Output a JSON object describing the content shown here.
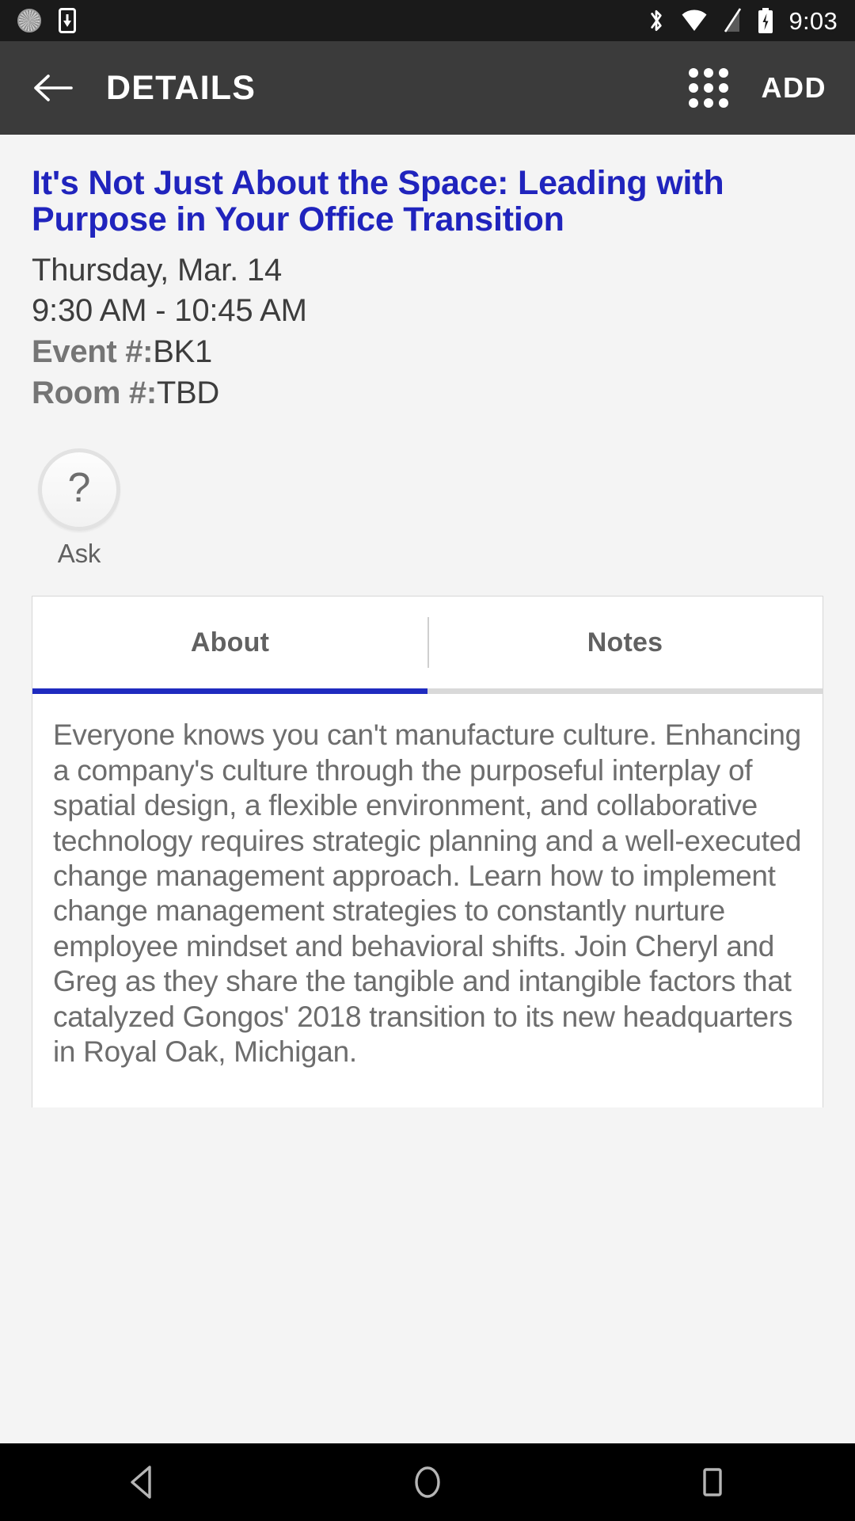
{
  "status_bar": {
    "time": "9:03",
    "left_icons": [
      {
        "name": "sync-icon"
      },
      {
        "name": "download-to-device-icon"
      }
    ],
    "right_icons": [
      {
        "name": "bluetooth-icon"
      },
      {
        "name": "wifi-icon"
      },
      {
        "name": "signal-off-icon"
      },
      {
        "name": "battery-charging-icon"
      }
    ]
  },
  "app_bar": {
    "back_label": "back-arrow",
    "title": "DETAILS",
    "grid_label": "apps-grid",
    "add_label": "ADD"
  },
  "event": {
    "title": "It's Not Just About the Space: Leading with Purpose in Your Office Transition",
    "date": "Thursday, Mar. 14",
    "time": "9:30 AM - 10:45 AM",
    "event_number_label": "Event #:",
    "event_number_value": "BK1",
    "room_number_label": "Room #:",
    "room_number_value": "TBD"
  },
  "ask": {
    "glyph": "?",
    "label": "Ask"
  },
  "tabs": [
    {
      "label": "About",
      "active": true
    },
    {
      "label": "Notes",
      "active": false
    }
  ],
  "about": {
    "text": "Everyone knows you can't manufacture culture. Enhancing a company's culture through the purposeful interplay of spatial design, a flexible environment, and collaborative technology requires strategic planning and a well-executed change management approach. Learn how to implement change management strategies to constantly nurture employee mindset and behavioral shifts. Join Cheryl and Greg as they share the tangible and intangible factors that catalyzed Gongos' 2018 transition to its new headquarters in Royal Oak, Michigan."
  },
  "nav_bar": {
    "back": "nav-back-icon",
    "home": "nav-home-icon",
    "recents": "nav-recents-icon"
  },
  "colors": {
    "title_blue": "#2024bd",
    "tab_indicator": "#1f2bbf",
    "app_bar": "#3b3b3b",
    "status_bar": "#1a1a1a",
    "page_bg": "#f4f4f4"
  }
}
